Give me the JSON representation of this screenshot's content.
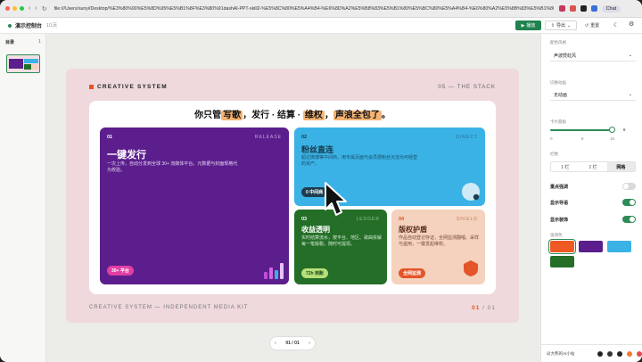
{
  "browser": {
    "url": "file:///Users/sunyi/Desktop/%E3%80%90%E5%8D%95%E5%B1%8F%E3%80%91dashAI-PPT-skill2-%E5%8C%80%E5%A4%B4-%E6%8D%A2%E5%B8%83%E5%B1%80%E5%BC%80%E5%A4%B4-%E6%80%A2%E5%8B%83%E5%B1%80...",
    "chat_label": "Chat"
  },
  "appbar": {
    "title": "演示控制台",
    "count": "1/1页",
    "play_label": "播放",
    "export_label": "导出",
    "reset_label": "重置"
  },
  "sidebar": {
    "heading": "目录",
    "count": "1"
  },
  "slide": {
    "brand": "CREATIVE SYSTEM",
    "section": "05 — THE STACK",
    "headline": {
      "p1": "你只管",
      "h1": "写歌",
      "p2": "，发行 · 结算 · ",
      "h2": "维权",
      "p3": "，",
      "h3": "声浪全包了",
      "p4": "。"
    },
    "cards": [
      {
        "num": "01",
        "tag": "RELEASE",
        "title": "一键发行",
        "desc": "一次上传，自动分发到全球 30+ 流媒体平台。元数据与封面规格代为校验。",
        "pill": "30+ 平台"
      },
      {
        "num": "02",
        "tag": "DIRECT",
        "title": "粉丝直连",
        "desc": "超过微博等中间商，用专属页面与会员把粉丝沉淀为可经营的资产。",
        "pill": "0 中间商"
      },
      {
        "num": "03",
        "tag": "LEDGER",
        "title": "收益透明",
        "desc": "实时结算流水，按平台、地区、歌曲拆解每一笔版税，随时可提现。",
        "pill": "72h 到账"
      },
      {
        "num": "04",
        "tag": "SHIELD",
        "title": "版权护盾",
        "desc": "作品自动登记存证，全网监测翻唱、采样与盗用，一键发起维权。",
        "pill": "全网监测"
      }
    ],
    "footer_left": "CREATIVE SYSTEM — INDEPENDENT MEDIA KIT",
    "page_current": "01",
    "page_total": "/ 01"
  },
  "pager": {
    "label": "01 / 01",
    "prev": "‹",
    "next": "›"
  },
  "panel": {
    "theme_label": "配色风格",
    "theme_value": "声波霓虹风",
    "anim_label": "切换动画",
    "anim_value": "无动画",
    "radius_label": "卡片圆角",
    "radius_value": "6",
    "radius_ticks": [
      "0",
      "8",
      "16"
    ],
    "layout_label": "栏数",
    "layout_options": [
      "1 栏",
      "2 栏",
      "网格"
    ],
    "layout_selected": "网格",
    "toggles": [
      {
        "label": "重点强调",
        "on": false
      },
      {
        "label": "显示导语",
        "on": true
      },
      {
        "label": "显示装饰",
        "on": true
      }
    ],
    "accent_label": "强调色",
    "accents": [
      "#ef5a24",
      "#5b1e8c",
      "#3bb2e5",
      "#246e28"
    ],
    "footer_text": "@大熊的AI小站"
  }
}
